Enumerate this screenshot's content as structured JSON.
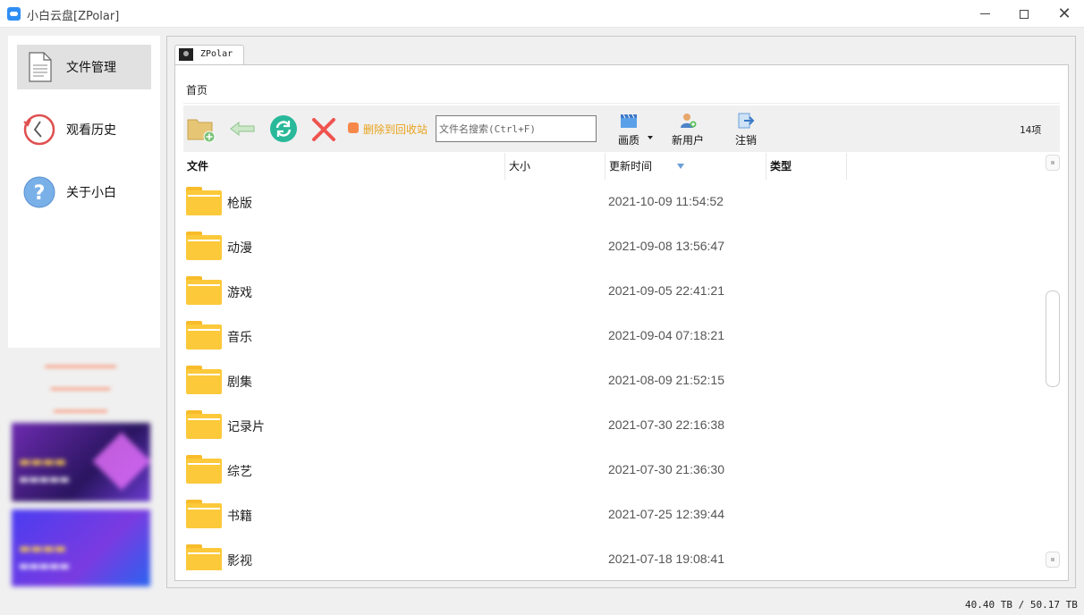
{
  "window": {
    "title": "小白云盘[ZPolar]"
  },
  "sidebar": {
    "items": [
      {
        "label": "文件管理",
        "icon": "document-icon",
        "active": true
      },
      {
        "label": "观看历史",
        "icon": "history-clock-icon",
        "active": false
      },
      {
        "label": "关于小白",
        "icon": "help-question-icon",
        "active": false
      }
    ]
  },
  "tab": {
    "label": "ZPolar"
  },
  "breadcrumb": "首页",
  "toolbar": {
    "delete_to_recycle_label": "删除到回收站",
    "search_placeholder": "文件名搜索(Ctrl+F)",
    "quality_label": "画质",
    "new_user_label": "新用户",
    "logout_label": "注销",
    "item_count": "14项"
  },
  "table": {
    "columns": [
      "文件",
      "大小",
      "更新时间",
      "类型"
    ],
    "sort_column": "更新时间",
    "rows": [
      {
        "name": "枪版",
        "time": "2021-10-09 11:54:52"
      },
      {
        "name": "动漫",
        "time": "2021-09-08 13:56:47"
      },
      {
        "name": "游戏",
        "time": "2021-09-05 22:41:21"
      },
      {
        "name": "音乐",
        "time": "2021-09-04 07:18:21"
      },
      {
        "name": "剧集",
        "time": "2021-08-09 21:52:15"
      },
      {
        "name": "记录片",
        "time": "2021-07-30 22:16:38"
      },
      {
        "name": "综艺",
        "time": "2021-07-30 21:36:30"
      },
      {
        "name": "书籍",
        "time": "2021-07-25 12:39:44"
      },
      {
        "name": "影视",
        "time": "2021-07-18 19:08:41"
      }
    ]
  },
  "status": {
    "storage": "40.40 TB / 50.17 TB"
  },
  "colors": {
    "folder": "#fcc93a",
    "accent_delete": "#f6894a",
    "delete_text": "#e8a21a",
    "promo_text": "#ff6a3d"
  }
}
